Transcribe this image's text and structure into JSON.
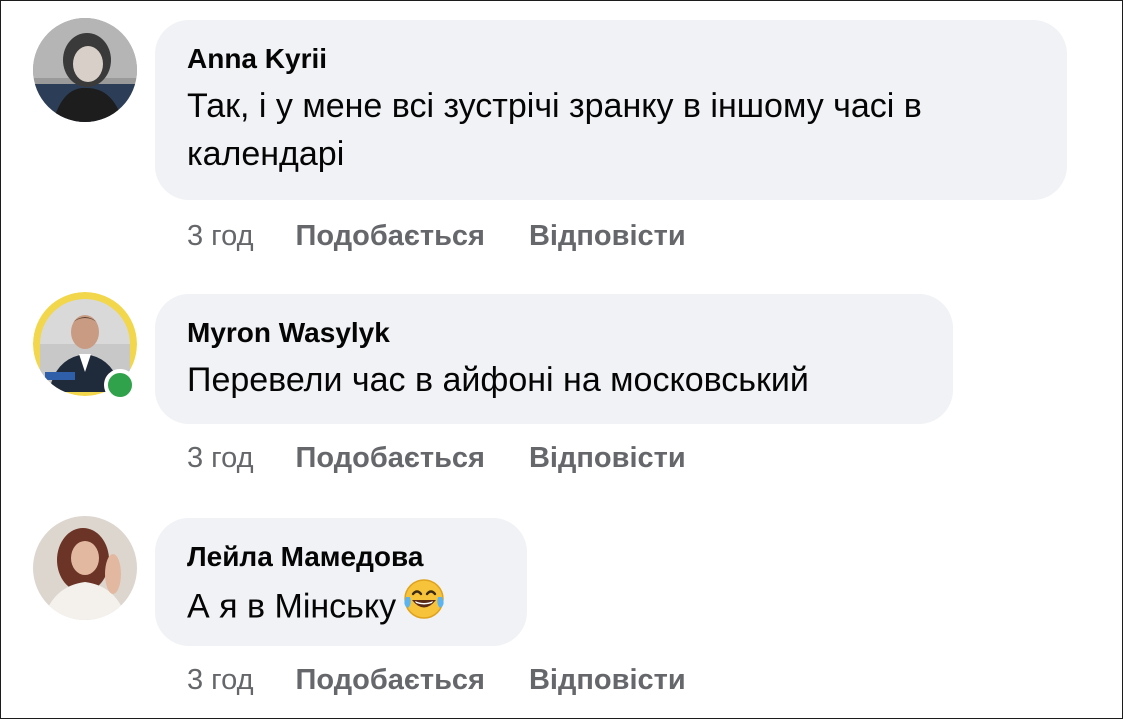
{
  "comments": [
    {
      "author": "Anna Kyrii",
      "text": "Так, і у мене всі зустрічі зранку в іншому часі в календарі",
      "time": "3 год",
      "like_label": "Подобається",
      "reply_label": "Відповісти",
      "online": false
    },
    {
      "author": "Myron Wasylyk",
      "text": "Перевели час в айфоні на московський",
      "time": "3 год",
      "like_label": "Подобається",
      "reply_label": "Відповісти",
      "online": true
    },
    {
      "author": "Лейла Мамедова",
      "text": "А я в Мінську",
      "emoji": "laughing-tears",
      "time": "3 год",
      "like_label": "Подобається",
      "reply_label": "Відповісти",
      "online": false
    }
  ],
  "colors": {
    "bubble_bg": "#f0f2f5",
    "secondary_text": "#65676b",
    "online_green": "#31a24c"
  }
}
